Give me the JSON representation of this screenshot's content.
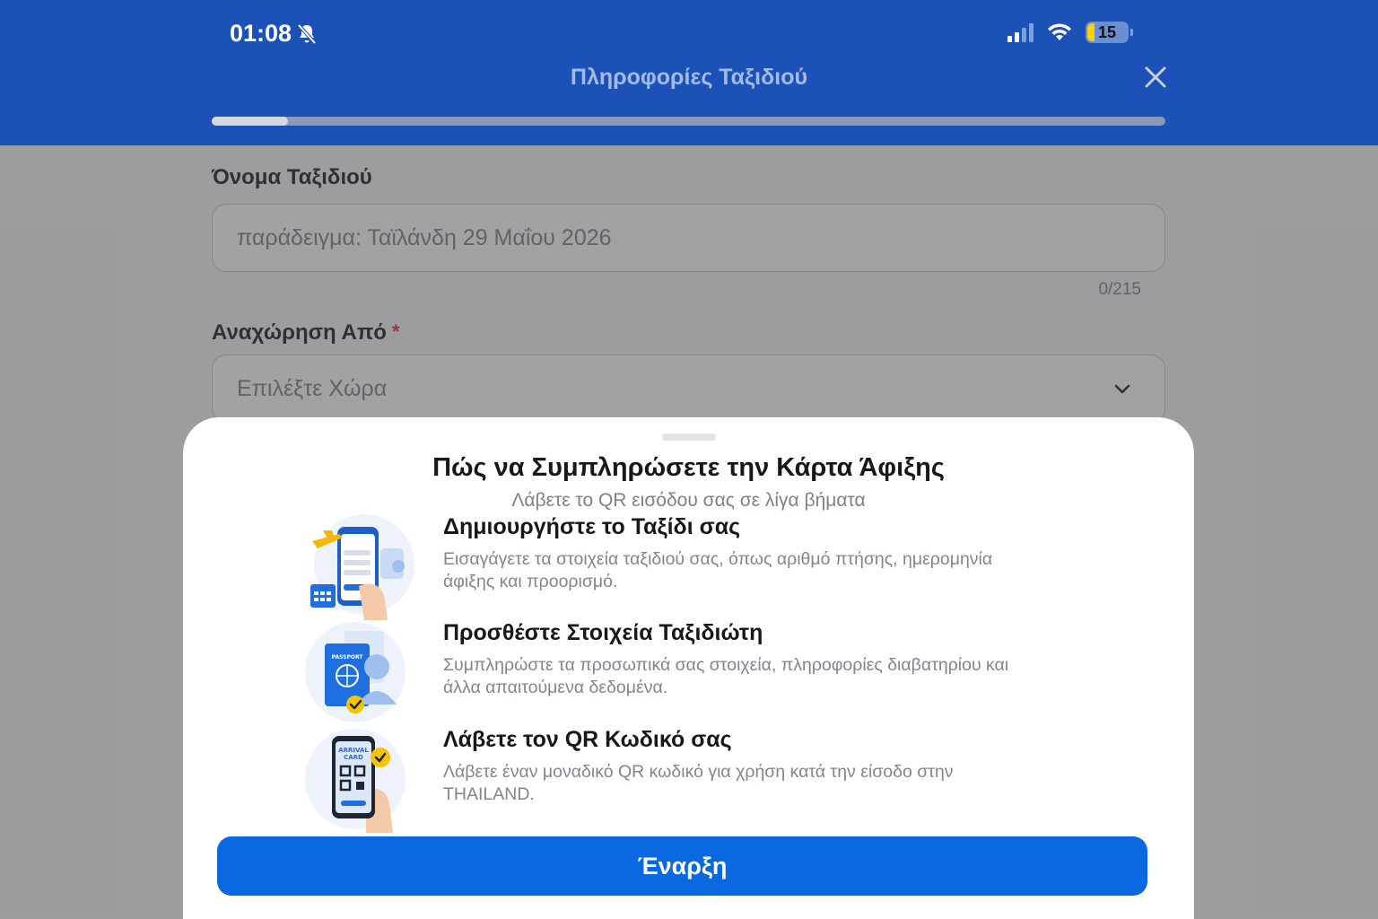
{
  "status_bar": {
    "time": "01:08",
    "battery": "15",
    "icons": [
      "bell-slash-icon",
      "signal-icon",
      "wifi-icon",
      "battery-icon"
    ]
  },
  "header": {
    "title": "Πληροφορίες Ταξιδιού",
    "close_icon": "close-icon",
    "progress": 0.08
  },
  "form": {
    "trip_name": {
      "label": "Όνομα Ταξιδιού",
      "placeholder": "παράδειγμα: Ταϊλάνδη 29 Μαΐου 2026",
      "counter": "0/215"
    },
    "departure": {
      "label": "Αναχώρηση Από",
      "required_mark": "*",
      "placeholder": "Επιλέξτε Χώρα"
    }
  },
  "sheet": {
    "title": "Πώς να Συμπληρώσετε την Κάρτα Άφιξης",
    "subtitle": "Λάβετε το QR εισόδου σας σε λίγα βήματα",
    "steps": [
      {
        "title": "Δημιουργήστε το Ταξίδι σας",
        "description": "Εισαγάγετε τα στοιχεία ταξιδιού σας, όπως αριθμό πτήσης, ημερομηνία άφιξης και προορισμό.",
        "icon": "trip-illustration-icon"
      },
      {
        "title": "Προσθέστε Στοιχεία Ταξιδιώτη",
        "description": "Συμπληρώστε τα προσωπικά σας στοιχεία, πληροφορίες διαβατηρίου και άλλα απαιτούμενα δεδομένα.",
        "icon": "passport-illustration-icon",
        "illustration_text": "PASSPORT"
      },
      {
        "title": "Λάβετε τον QR Κωδικό σας",
        "description": "Λάβετε έναν μοναδικό QR κωδικό για χρήση κατά την είσοδο στην THAILAND.",
        "icon": "qr-illustration-icon",
        "illustration_text": "ARRIVAL CARD"
      }
    ],
    "start_button": "Έναρξη"
  },
  "colors": {
    "header_bg": "#1c52b8",
    "primary_button": "#0a68e0",
    "required": "#e53935"
  }
}
